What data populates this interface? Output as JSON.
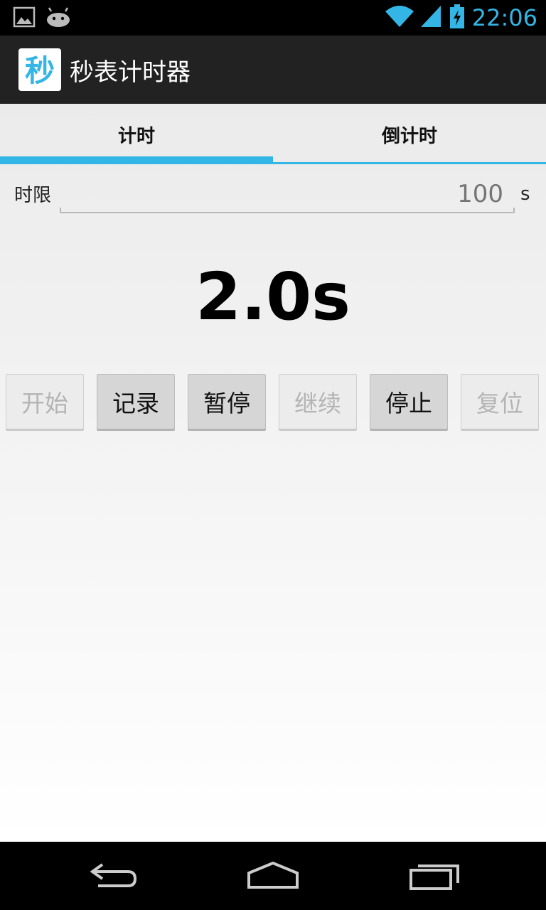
{
  "status_bar": {
    "time": "22:06",
    "icons": [
      "image-icon",
      "android-icon",
      "wifi-icon",
      "signal-icon",
      "battery-charging-icon"
    ]
  },
  "action_bar": {
    "app_icon_char": "秒",
    "title": "秒表计时器"
  },
  "tabs": [
    {
      "label": "计时",
      "selected": true
    },
    {
      "label": "倒计时",
      "selected": false
    }
  ],
  "limit": {
    "label": "时限",
    "value": "100",
    "unit": "s"
  },
  "timer": {
    "display": "2.0s"
  },
  "buttons": [
    {
      "label": "开始",
      "enabled": false
    },
    {
      "label": "记录",
      "enabled": true
    },
    {
      "label": "暂停",
      "enabled": true
    },
    {
      "label": "继续",
      "enabled": false
    },
    {
      "label": "停止",
      "enabled": true
    },
    {
      "label": "复位",
      "enabled": false
    }
  ],
  "nav_bar": {
    "icons": [
      "back-icon",
      "home-icon",
      "recent-apps-icon"
    ]
  },
  "colors": {
    "accent": "#33b5e5",
    "action_bar": "#222222",
    "status_bar": "#000000"
  }
}
